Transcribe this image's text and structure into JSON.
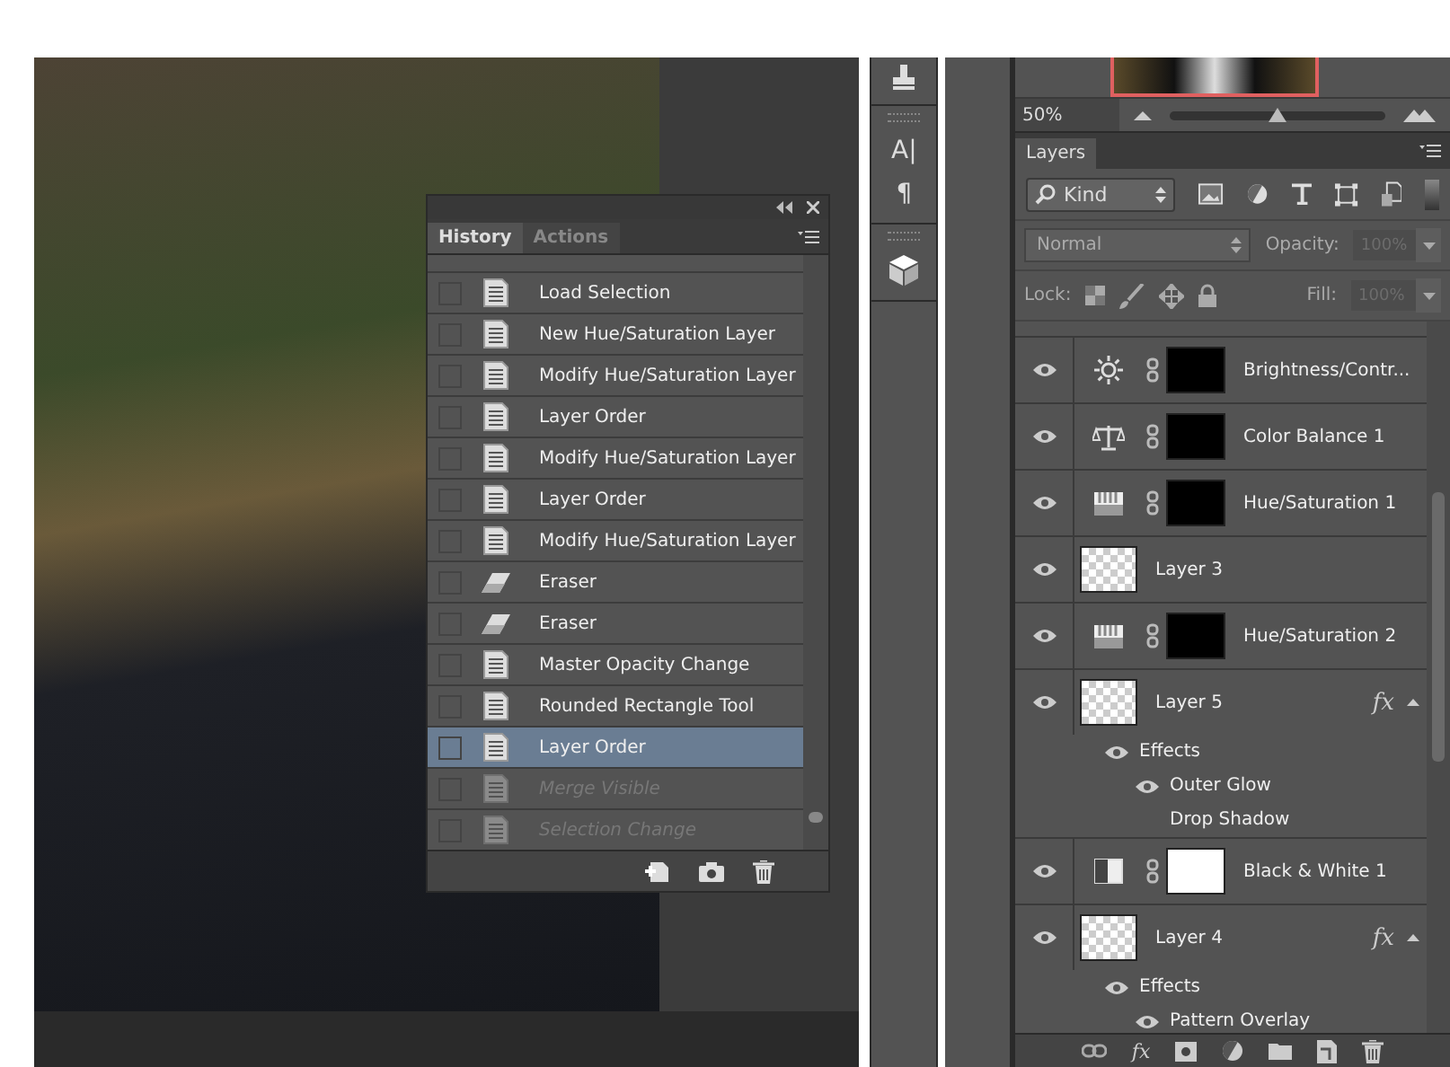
{
  "history": {
    "tabs": [
      {
        "label": "History",
        "selected": true
      },
      {
        "label": "Actions",
        "selected": false
      }
    ],
    "items": [
      {
        "label": "Load Selection",
        "kind": "document",
        "selected": false,
        "disabled": false
      },
      {
        "label": "New Hue/Saturation Layer",
        "kind": "document",
        "selected": false,
        "disabled": false
      },
      {
        "label": "Modify Hue/Saturation Layer",
        "kind": "document",
        "selected": false,
        "disabled": false
      },
      {
        "label": "Layer Order",
        "kind": "document",
        "selected": false,
        "disabled": false
      },
      {
        "label": "Modify Hue/Saturation Layer",
        "kind": "document",
        "selected": false,
        "disabled": false
      },
      {
        "label": "Layer Order",
        "kind": "document",
        "selected": false,
        "disabled": false
      },
      {
        "label": "Modify Hue/Saturation Layer",
        "kind": "document",
        "selected": false,
        "disabled": false
      },
      {
        "label": "Eraser",
        "kind": "eraser",
        "selected": false,
        "disabled": false
      },
      {
        "label": "Eraser",
        "kind": "eraser",
        "selected": false,
        "disabled": false
      },
      {
        "label": "Master Opacity Change",
        "kind": "document",
        "selected": false,
        "disabled": false
      },
      {
        "label": "Rounded Rectangle Tool",
        "kind": "document",
        "selected": false,
        "disabled": false
      },
      {
        "label": "Layer Order",
        "kind": "document",
        "selected": true,
        "disabled": false
      },
      {
        "label": "Merge Visible",
        "kind": "document",
        "selected": false,
        "disabled": true
      },
      {
        "label": "Selection Change",
        "kind": "document",
        "selected": false,
        "disabled": true
      }
    ]
  },
  "toolbar": [
    {
      "glyph": "A|"
    },
    {
      "glyph": "¶"
    }
  ],
  "navigator": {
    "zoom": "50%",
    "level": 0.5
  },
  "layers": {
    "tabs": [
      {
        "label": "Layers",
        "selected": true
      }
    ],
    "filter": "Kind",
    "blend_mode": "Normal",
    "opacity_label": "Opacity:",
    "opacity": "100%",
    "lock_label": "Lock:",
    "fill_label": "Fill:",
    "fill": "100%",
    "items": [
      {
        "name": "Brightness/Contr...",
        "kind": "brightness",
        "visible": true
      },
      {
        "name": "Color Balance 1",
        "kind": "balance",
        "visible": true
      },
      {
        "name": "Hue/Saturation 1",
        "kind": "hue",
        "visible": true
      },
      {
        "name": "Layer 3",
        "kind": "pixel",
        "visible": true
      },
      {
        "name": "Hue/Saturation 2",
        "kind": "hue",
        "visible": true
      },
      {
        "name": "Layer 5",
        "kind": "pixel",
        "visible": true,
        "fx": "fx",
        "effects": {
          "label": "Effects",
          "visible": true,
          "children": [
            {
              "name": "Outer Glow",
              "visible": true
            },
            {
              "name": "Drop Shadow",
              "visible": false
            }
          ]
        }
      },
      {
        "name": "Black & White 1",
        "kind": "bw",
        "visible": true
      },
      {
        "name": "Layer 4",
        "kind": "pixel",
        "visible": true,
        "fx": "fx",
        "effects": {
          "label": "Effects",
          "visible": true,
          "children": [
            {
              "name": "Pattern Overlay",
              "visible": true
            }
          ]
        }
      }
    ],
    "bottom_fx": "fx"
  }
}
